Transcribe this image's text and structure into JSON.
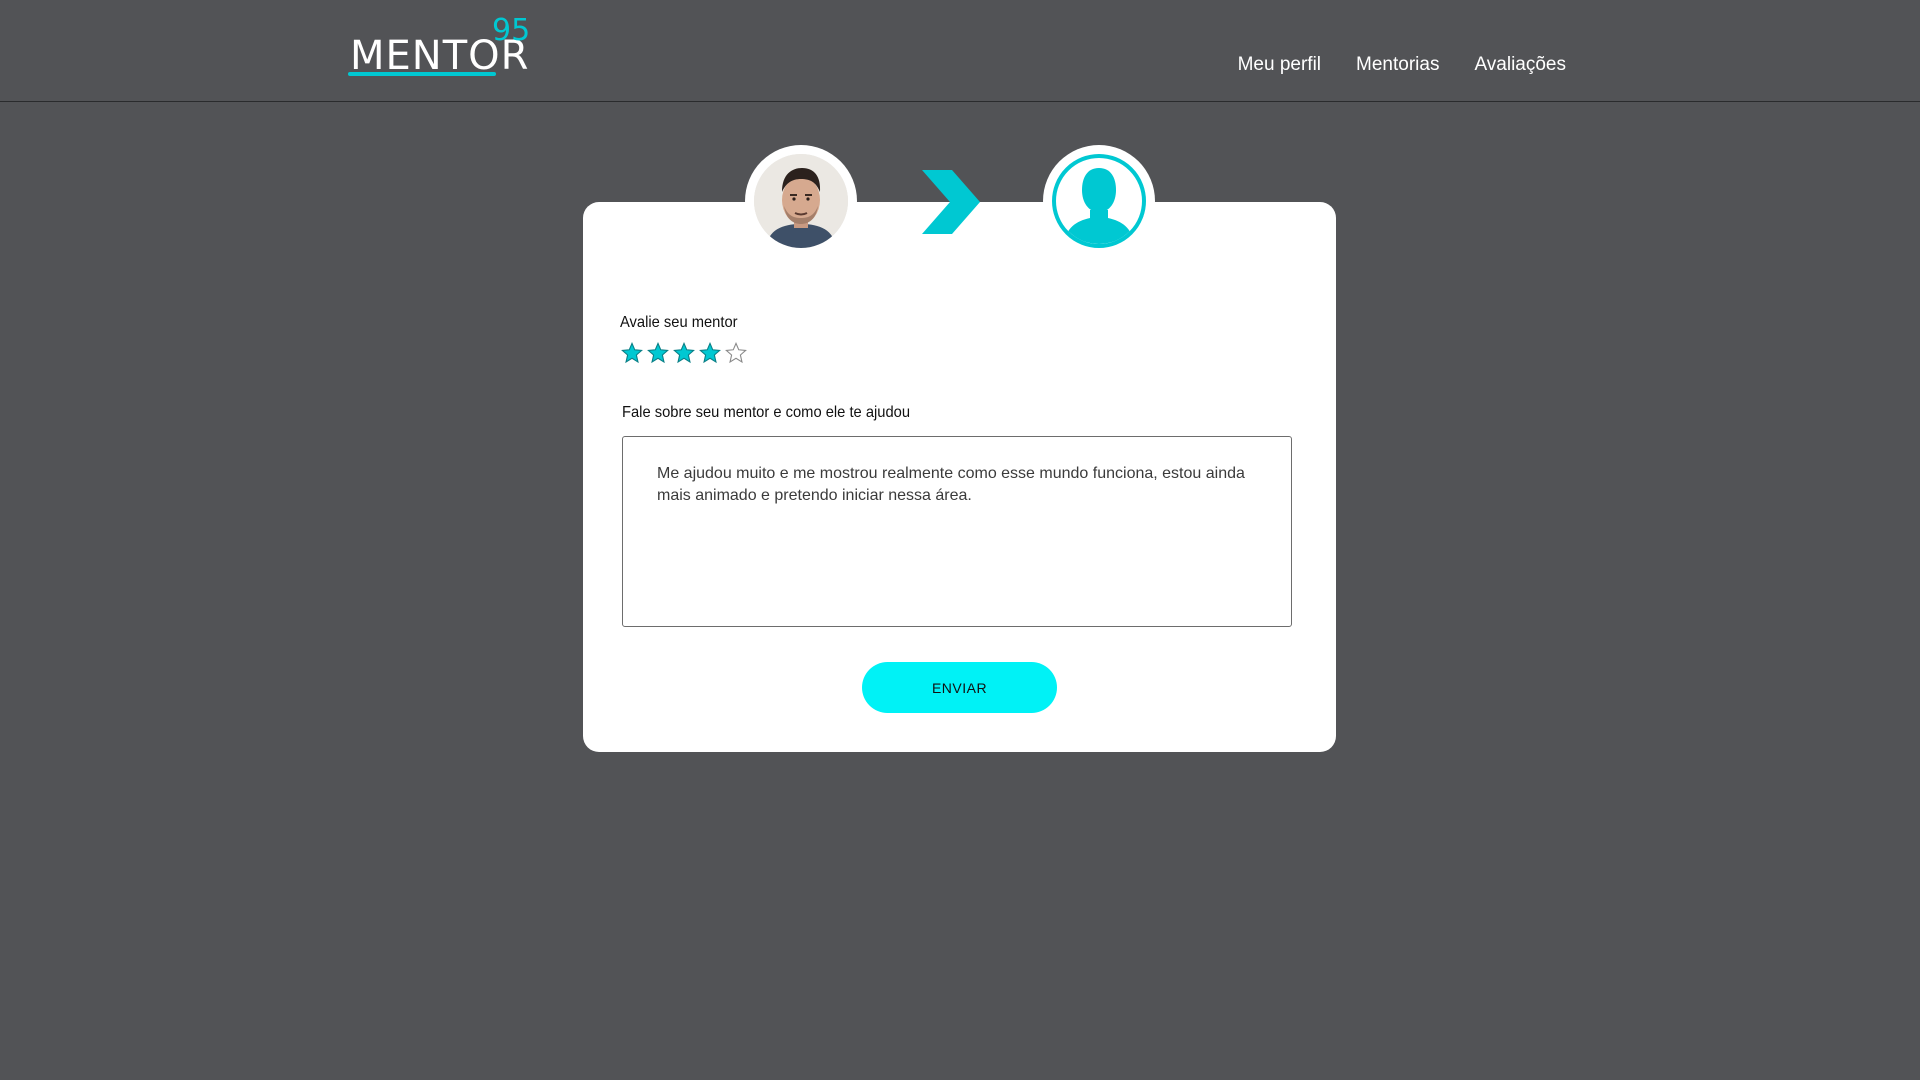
{
  "header": {
    "logo_text": "MENTOR",
    "logo_sup": "95",
    "nav": [
      "Meu perfil",
      "Mentorias",
      "Avaliações"
    ]
  },
  "review": {
    "rating_label": "Avalie seu mentor",
    "rating": 4,
    "rating_max": 5,
    "comment_label": "Fale sobre seu mentor e como ele te ajudou",
    "comment_value": "Me ajudou muito e me mostrou realmente como esse mundo funciona, estou ainda mais animado e pretendo iniciar nessa área.",
    "submit_label": "ENVIAR"
  },
  "colors": {
    "accent": "#00c8d2",
    "button": "#00f2f6",
    "background": "#525356",
    "card": "#ffffff"
  },
  "icons": {
    "mentee": "mentee-photo",
    "transition": "chevron-right-icon",
    "mentor": "user-silhouette-icon",
    "star": "star-icon"
  }
}
